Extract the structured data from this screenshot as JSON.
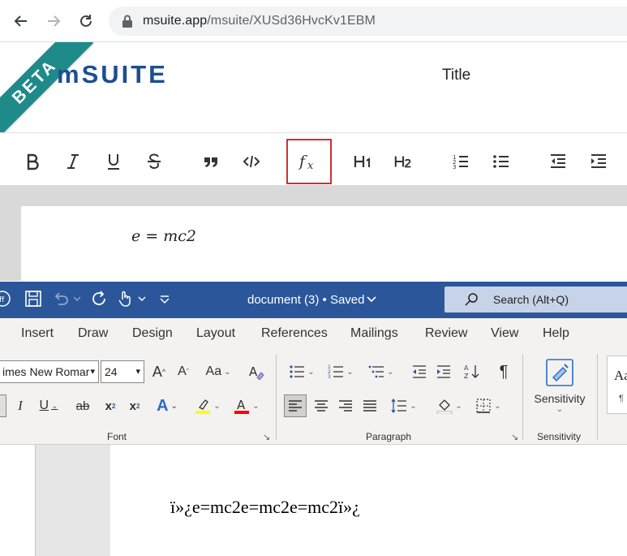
{
  "browser": {
    "url_host": "msuite.app",
    "url_path": "/msuite/XUSd36HvcKv1EBM"
  },
  "app": {
    "beta_label": "BETA",
    "logo_text": "mSUITE",
    "document_title": "Title"
  },
  "editor_toolbar": {
    "buttons": [
      {
        "name": "bold",
        "glyph": "B"
      },
      {
        "name": "italic",
        "glyph": "I"
      },
      {
        "name": "underline",
        "glyph": "U"
      },
      {
        "name": "strikethrough",
        "glyph": "S"
      },
      {
        "name": "blockquote",
        "glyph": "❞"
      },
      {
        "name": "code",
        "glyph": "</>"
      },
      {
        "name": "formula",
        "glyph": "fx",
        "highlighted": true
      },
      {
        "name": "heading-1",
        "glyph": "H1"
      },
      {
        "name": "heading-2",
        "glyph": "H2"
      },
      {
        "name": "ordered-list"
      },
      {
        "name": "bullet-list"
      },
      {
        "name": "outdent"
      },
      {
        "name": "indent"
      }
    ],
    "highlight_color": "#d32f2f"
  },
  "editor": {
    "formula_text": "e = mc2"
  },
  "word": {
    "document_name": "document (3) • Saved",
    "search_placeholder": "Search (Alt+Q)",
    "tabs": [
      "Insert",
      "Draw",
      "Design",
      "Layout",
      "References",
      "Mailings",
      "Review",
      "View",
      "Help"
    ],
    "font_name": "imes New Romar",
    "font_size": "24",
    "groups": {
      "font": "Font",
      "paragraph": "Paragraph",
      "sensitivity": "Sensitivity"
    },
    "sensitivity_button": "Sensitivity",
    "styles_preview": "Aa",
    "styles_mark": "¶",
    "grow_font": "A",
    "shrink_font": "A",
    "change_case": "Aa",
    "italic": "I",
    "underline": "U",
    "strikethrough": "ab",
    "subscript": "x",
    "superscript": "x",
    "text_effects": "A",
    "font_color": "A",
    "pilcrow": "¶",
    "body_text": "ï»¿e=mc2e=mc2e=mc2ï»¿"
  },
  "colors": {
    "word_blue": "#2b579a",
    "beta_ribbon": "#1f8a8a",
    "logo": "#1c4f8f",
    "highlight_yellow": "#ffff00",
    "font_color_red": "#ff0000"
  }
}
